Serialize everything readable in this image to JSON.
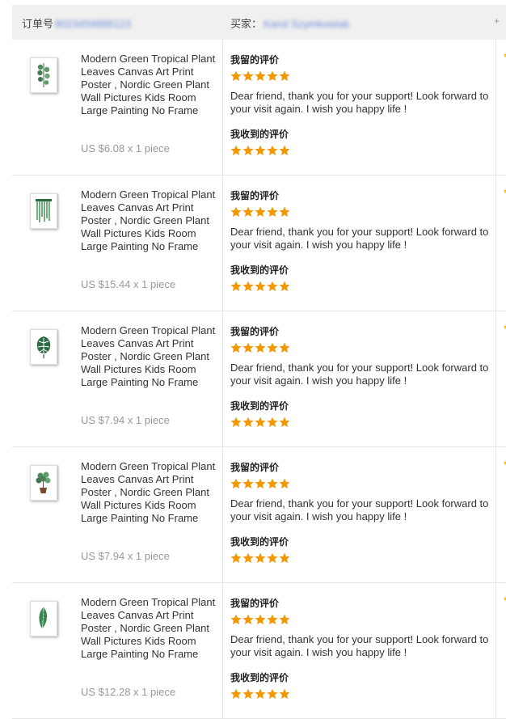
{
  "header": {
    "order_label": "订单号",
    "order_value": "8023459888123",
    "buyer_label": "买家：",
    "buyer_value": "Karol Szymkowiak",
    "corner_glyph": "+"
  },
  "labels": {
    "my_feedback": "我留的评价",
    "received_feedback": "我收到的评价"
  },
  "colors": {
    "star": "#f39800",
    "accent": "#e8b500"
  },
  "items": [
    {
      "icon": "eucalyptus-print-icon",
      "title": "Modern Green Tropical Plant Leaves Canvas Art Print Poster , Nordic Green Plant Wall Pictures Kids Room Large Painting No Frame",
      "price": "US $6.08 x 1 piece",
      "my_rating": 5,
      "received_rating": 5,
      "comment": "Dear friend, thank you for your support! Look forward to your visit again. I wish you happy life !"
    },
    {
      "icon": "hanging-vine-print-icon",
      "title": "Modern Green Tropical Plant Leaves Canvas Art Print Poster , Nordic Green Plant Wall Pictures Kids Room Large Painting No Frame",
      "price": "US $15.44 x 1 piece",
      "my_rating": 5,
      "received_rating": 5,
      "comment": "Dear friend, thank you for your support! Look forward to your visit again. I wish you happy life !"
    },
    {
      "icon": "monstera-leaf-print-icon",
      "title": "Modern Green Tropical Plant Leaves Canvas Art Print Poster , Nordic Green Plant Wall Pictures Kids Room Large Painting No Frame",
      "price": "US $7.94 x 1 piece",
      "my_rating": 5,
      "received_rating": 5,
      "comment": "Dear friend, thank you for your support! Look forward to your visit again. I wish you happy life !"
    },
    {
      "icon": "potted-plant-print-icon",
      "title": "Modern Green Tropical Plant Leaves Canvas Art Print Poster , Nordic Green Plant Wall Pictures Kids Room Large Painting No Frame",
      "price": "US $7.94 x 1 piece",
      "my_rating": 5,
      "received_rating": 5,
      "comment": "Dear friend, thank you for your support! Look forward to your visit again. I wish you happy life !"
    },
    {
      "icon": "banana-leaf-print-icon",
      "title": "Modern Green Tropical Plant Leaves Canvas Art Print Poster , Nordic Green Plant Wall Pictures Kids Room Large Painting No Frame",
      "price": "US $12.28 x 1 piece",
      "my_rating": 5,
      "received_rating": 5,
      "comment": "Dear friend, thank you for your support! Look forward to your visit again. I wish you happy life !"
    }
  ]
}
